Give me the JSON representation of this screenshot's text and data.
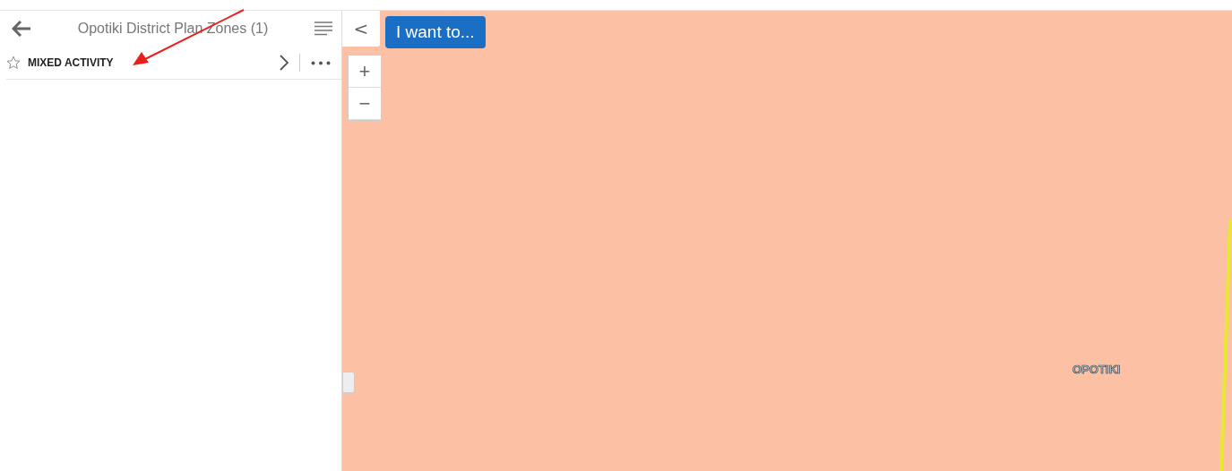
{
  "panel": {
    "title": "Opotiki District Plan Zones (1)",
    "results": [
      {
        "label": "MIXED ACTIVITY",
        "favorite": false
      }
    ]
  },
  "map": {
    "toggle_button": "<",
    "action_button": "I want to...",
    "zoom_in": "+",
    "zoom_out": "−",
    "place_label": "OPOTIKI"
  }
}
